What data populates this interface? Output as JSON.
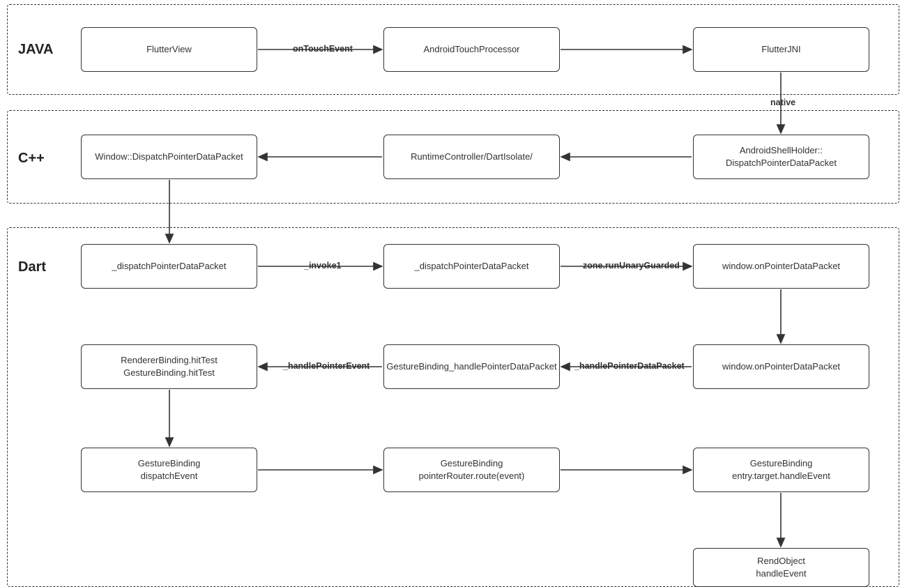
{
  "sections": {
    "java": {
      "label": "JAVA"
    },
    "cpp": {
      "label": "C++"
    },
    "dart": {
      "label": "Dart"
    }
  },
  "nodes": {
    "java1": {
      "line1": "FlutterView"
    },
    "java2": {
      "line1": "AndroidTouchProcessor"
    },
    "java3": {
      "line1": "FlutterJNI"
    },
    "cpp1": {
      "line1": "AndroidShellHolder::",
      "line2": "DispatchPointerDataPacket"
    },
    "cpp2": {
      "line1": "RuntimeController/DartIsolate/"
    },
    "cpp3": {
      "line1": "Window::DispatchPointerDataPacket"
    },
    "dart1": {
      "line1": "_dispatchPointerDataPacket"
    },
    "dart2": {
      "line1": "_dispatchPointerDataPacket"
    },
    "dart3": {
      "line1": "window.onPointerDataPacket"
    },
    "dart4": {
      "line1": "window.onPointerDataPacket"
    },
    "dart5": {
      "line1": "GestureBinding_handlePointerDataPacket"
    },
    "dart6": {
      "line1": "RendererBinding.hitTest",
      "line2": "GestureBinding.hitTest"
    },
    "dart7": {
      "line1": "GestureBinding",
      "line2": "dispatchEvent"
    },
    "dart8": {
      "line1": "GestureBinding",
      "line2": "pointerRouter.route(event)"
    },
    "dart9": {
      "line1": "GestureBinding",
      "line2": "entry.target.handleEvent"
    },
    "dart10": {
      "line1": "RendObject",
      "line2": "handleEvent"
    }
  },
  "edges": {
    "e_java1_java2": {
      "label": "onTouchEvent"
    },
    "e_java3_cpp1": {
      "label": "native"
    },
    "e_dart1_dart2": {
      "label": "_invoke1"
    },
    "e_dart2_dart3": {
      "label": "zone.runUnaryGuarded"
    },
    "e_dart4_dart5": {
      "label": "_handlePointerDataPacket"
    },
    "e_dart5_dart6": {
      "label": "_handlePointerEvent"
    }
  }
}
